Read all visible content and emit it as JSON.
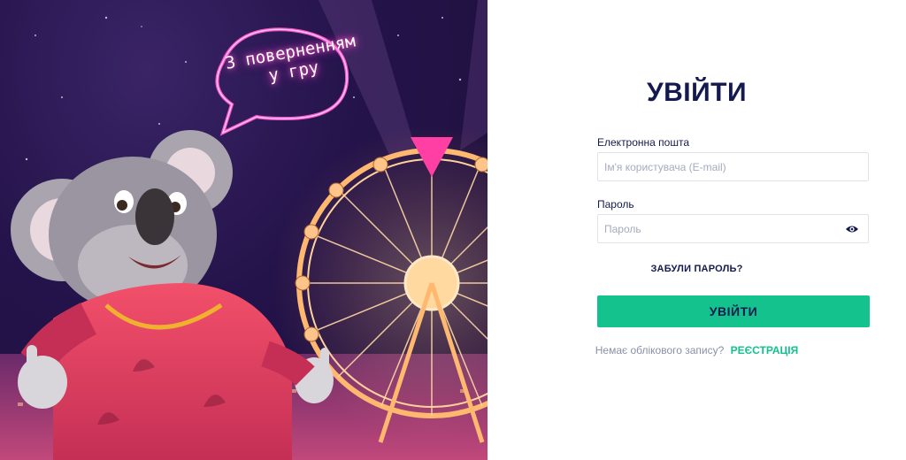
{
  "hero": {
    "bubble_line1": "З поверненням",
    "bubble_line2": "у гру"
  },
  "form": {
    "title": "УВІЙТИ",
    "email_label": "Електронна пошта",
    "email_placeholder": "Ім'я користувача (E-mail)",
    "email_value": "",
    "password_label": "Пароль",
    "password_placeholder": "Пароль",
    "password_value": "",
    "forgot_label": "ЗАБУЛИ ПАРОЛЬ?",
    "submit_label": "УВІЙТИ",
    "no_account_text": "Немає облікового запису?",
    "register_label": "РЕЄСТРАЦІЯ"
  },
  "icons": {
    "password_toggle": "eye-icon"
  },
  "colors": {
    "accent": "#13c28d",
    "title": "#141a4d",
    "hero_bg": "#24134a",
    "neon": "#ff5ad0"
  }
}
